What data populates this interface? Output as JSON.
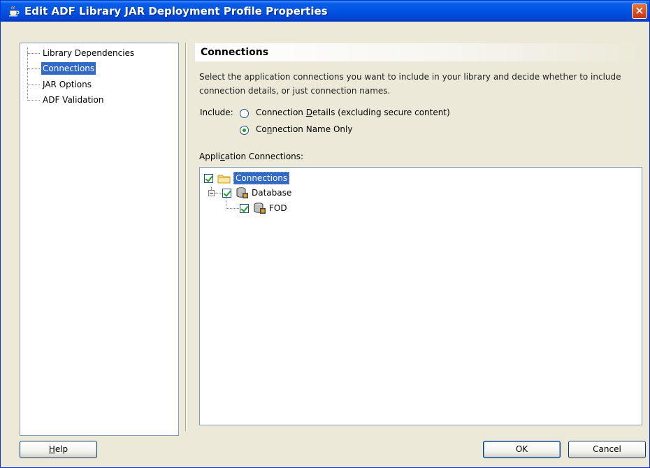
{
  "window": {
    "title": "Edit ADF Library JAR Deployment Profile Properties",
    "close_glyph": "✕"
  },
  "nav": {
    "items": [
      {
        "label": "Library Dependencies",
        "selected": false
      },
      {
        "label": "Connections",
        "selected": true
      },
      {
        "label": "JAR Options",
        "selected": false
      },
      {
        "label": "ADF Validation",
        "selected": false
      }
    ]
  },
  "section": {
    "title": "Connections",
    "description": "Select the application connections you want to include in your library and decide whether to include connection details, or just connection names."
  },
  "include": {
    "label": "Include:",
    "options": [
      {
        "label_pre": "Connection ",
        "mnemonic": "D",
        "label_post": "etails (excluding secure content)",
        "selected": false
      },
      {
        "label_pre": "Co",
        "mnemonic": "n",
        "label_post": "nection Name Only",
        "selected": true
      }
    ]
  },
  "app_connections": {
    "label_pre": "Appli",
    "mnemonic": "c",
    "label_post": "ation Connections:",
    "tree": [
      {
        "label": "Connections",
        "checked": true,
        "icon": "folder-icon",
        "selected": true
      },
      {
        "label": "Database",
        "checked": true,
        "icon": "database-icon",
        "expanded": true
      },
      {
        "label": "FOD",
        "checked": true,
        "icon": "database-connection-icon"
      }
    ]
  },
  "buttons": {
    "help": {
      "mnemonic": "H",
      "rest": "elp"
    },
    "ok": "OK",
    "cancel": "Cancel"
  }
}
